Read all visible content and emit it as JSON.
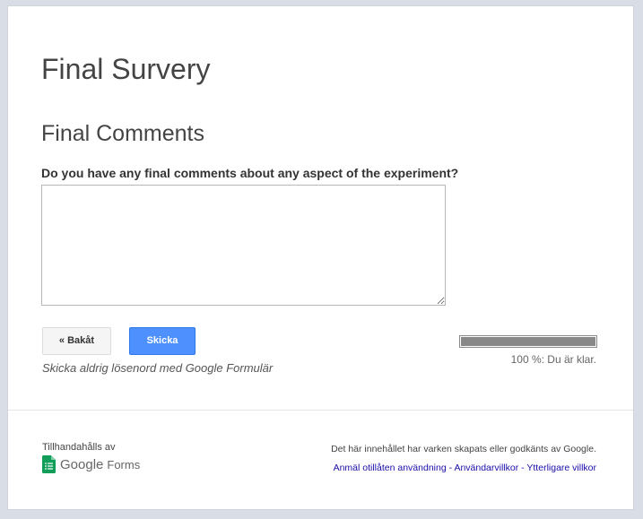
{
  "form": {
    "title": "Final Survery",
    "section_title": "Final Comments",
    "question": "Do you have any final comments about any aspect of the experiment?",
    "answer_value": ""
  },
  "buttons": {
    "back_label": "« Bakåt",
    "submit_label": "Skicka"
  },
  "warning": "Skicka aldrig lösenord med Google Formulär",
  "progress": {
    "percent": 100,
    "label": "100 %: Du är klar."
  },
  "footer": {
    "powered_by": "Tillhandahålls av",
    "logo_google": "Google",
    "logo_forms": "Forms",
    "disclaimer": "Det här innehållet har varken skapats eller godkänts av Google.",
    "links": {
      "report": "Anmäl otillåten användning",
      "terms": "Användarvillkor",
      "additional": "Ytterligare villkor",
      "separator": " - "
    }
  },
  "colors": {
    "accent": "#4d90fe",
    "link": "#1a0dab",
    "forms_green": "#0f9d58"
  },
  "icons": {
    "logo": "google-forms-icon"
  }
}
